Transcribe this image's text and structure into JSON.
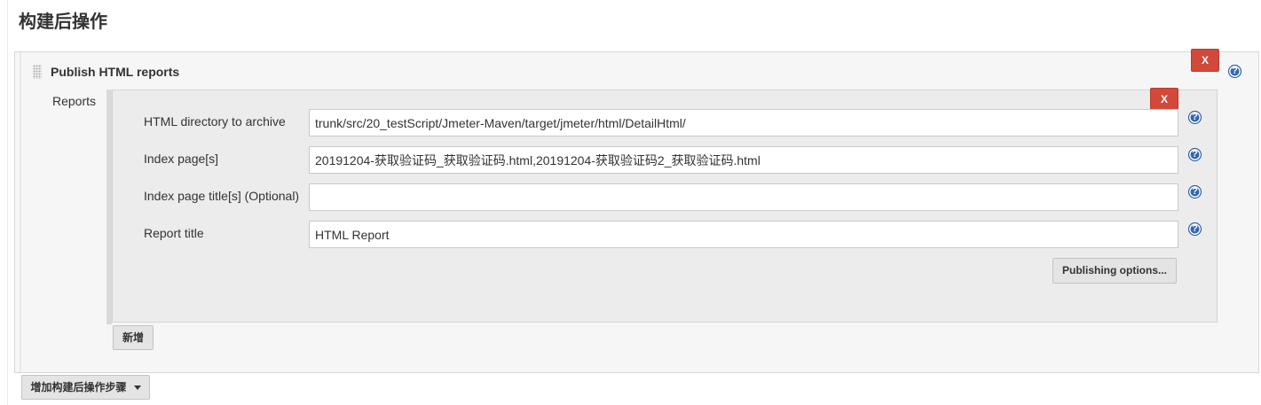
{
  "section": {
    "title": "构建后操作"
  },
  "publisher": {
    "title": "Publish HTML reports",
    "delete_label": "X",
    "help_icon": "question-circle-icon"
  },
  "reports": {
    "label": "Reports",
    "entry": {
      "delete_label": "X",
      "fields": [
        {
          "label": "HTML directory to archive",
          "value": "trunk/src/20_testScript/Jmeter-Maven/target/jmeter/html/DetailHtml/"
        },
        {
          "label": "Index page[s]",
          "value": "20191204-获取验证码_获取验证码.html,20191204-获取验证码2_获取验证码.html"
        },
        {
          "label": "Index page title[s] (Optional)",
          "value": ""
        },
        {
          "label": "Report title",
          "value": "HTML Report"
        }
      ],
      "publishing_options_label": "Publishing options..."
    },
    "add_label": "新增"
  },
  "add_step_button": {
    "label": "增加构建后操作步骤"
  },
  "colors": {
    "danger": "#d24939",
    "help_blue": "#2f68b4",
    "panel_bg": "#f6f6f6"
  }
}
